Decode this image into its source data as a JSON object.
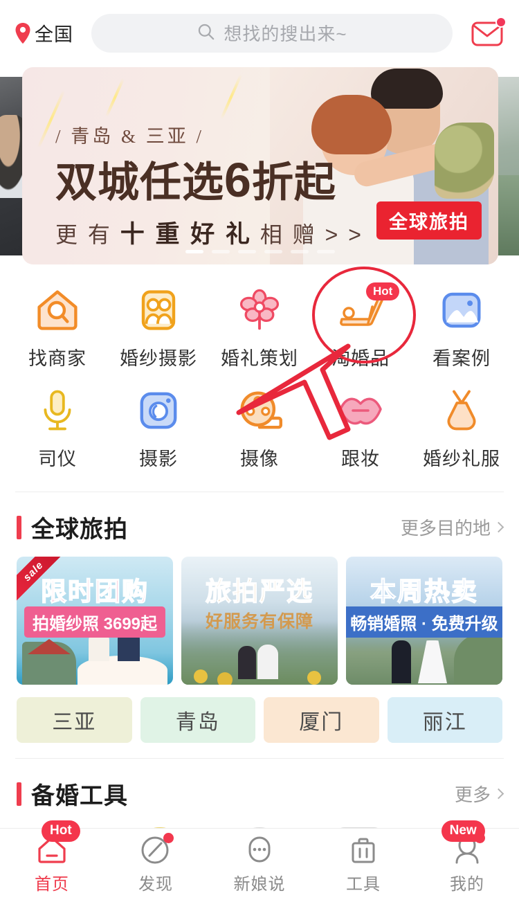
{
  "header": {
    "location": "全国",
    "location_icon": "location-pin-icon",
    "search_placeholder": "想找的搜出来~",
    "search_icon": "search-icon",
    "mail_icon": "mail-envelope-icon",
    "mail_has_unread": true
  },
  "banner": {
    "subtitle": "/ 青岛 & 三亚 /",
    "title_left": "双城任选",
    "title_big": "6",
    "title_right": "折起",
    "third_pre": "更 有 ",
    "third_bold": "十 重 好 礼",
    "third_post": " 相 赠 > >",
    "badge": "全球旅拍",
    "dots_count": 6,
    "active_dot": 0
  },
  "quick_grid": [
    {
      "label": "找商家",
      "icon": "house-search-icon",
      "badge": ""
    },
    {
      "label": "婚纱摄影",
      "icon": "couple-photo-icon",
      "badge": ""
    },
    {
      "label": "婚礼策划",
      "icon": "flower-icon",
      "badge": ""
    },
    {
      "label": "淘婚品",
      "icon": "high-heel-shoe-icon",
      "badge": "Hot"
    },
    {
      "label": "看案例",
      "icon": "picture-icon",
      "badge": ""
    },
    {
      "label": "司仪",
      "icon": "microphone-icon",
      "badge": ""
    },
    {
      "label": "摄影",
      "icon": "camera-icon",
      "badge": ""
    },
    {
      "label": "摄像",
      "icon": "film-reel-icon",
      "badge": ""
    },
    {
      "label": "跟妆",
      "icon": "lips-icon",
      "badge": ""
    },
    {
      "label": "婚纱礼服",
      "icon": "wedding-dress-icon",
      "badge": ""
    }
  ],
  "travel_section": {
    "title": "全球旅拍",
    "more": "更多目的地",
    "cards": [
      {
        "title": "限时团购",
        "badge": "拍婚纱照 3699起",
        "sub": "",
        "ribbon": "sale"
      },
      {
        "title": "旅拍严选",
        "badge": "",
        "sub": "好服务有保障",
        "ribbon": ""
      },
      {
        "title": "本周热卖",
        "badge": "畅销婚照 · 免费升级",
        "sub": "",
        "ribbon": ""
      }
    ],
    "destinations": [
      {
        "label": "三亚",
        "color": "#eef0d8"
      },
      {
        "label": "青岛",
        "color": "#e0f3e6"
      },
      {
        "label": "厦门",
        "color": "#fbe7d2"
      },
      {
        "label": "丽江",
        "color": "#d9eef7"
      }
    ]
  },
  "tools_section": {
    "title": "备婚工具",
    "more": "更多",
    "tools": [
      {
        "icon": "budget-book-icon",
        "badge": "Hot"
      },
      {
        "icon": "smiley-icon",
        "badge": ""
      },
      {
        "icon": "face-icon",
        "badge": ""
      },
      {
        "icon": "card-icon",
        "badge": ""
      },
      {
        "icon": "checklist-icon",
        "badge": "New"
      }
    ]
  },
  "tabbar": [
    {
      "label": "首页",
      "icon": "home-icon",
      "active": true,
      "dot": false
    },
    {
      "label": "发现",
      "icon": "compass-icon",
      "active": false,
      "dot": true
    },
    {
      "label": "新娘说",
      "icon": "chat-icon",
      "active": false,
      "dot": false
    },
    {
      "label": "工具",
      "icon": "toolbox-icon",
      "active": false,
      "dot": false
    },
    {
      "label": "我的",
      "icon": "person-icon",
      "active": false,
      "dot": true
    }
  ],
  "annotation": {
    "highlight_target": "淘婚品",
    "highlight_shape": "red-ellipse",
    "cursor": "red-arrow-cursor",
    "accent_red": "#ef3d4e",
    "badge_red": "#f4364c"
  }
}
